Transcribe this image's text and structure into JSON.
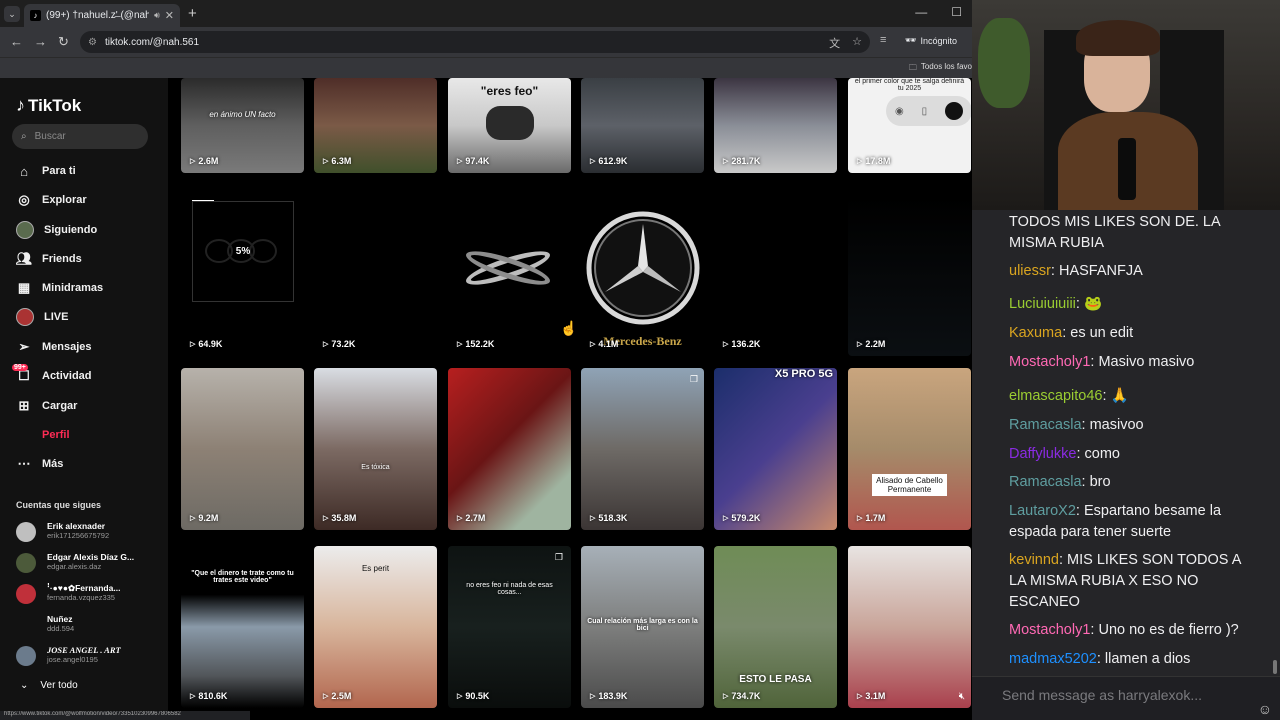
{
  "browser": {
    "tab_title": "(99+) †nahuel.z'̶ (@nah.56",
    "url": "tiktok.com/@nah.561",
    "incognito_label": "Incógnito",
    "bookmarks_all": "Todos los favo",
    "status_url": "https://www.tiktok.com/@wolfmotion/video/7335102309967806582"
  },
  "sidebar": {
    "brand": "TikTok",
    "search_placeholder": "Buscar",
    "nav": [
      {
        "label": "Para ti",
        "icon": "home-icon"
      },
      {
        "label": "Explorar",
        "icon": "compass-icon"
      },
      {
        "label": "Siguiendo",
        "icon": "following-avatar-icon"
      },
      {
        "label": "Friends",
        "icon": "friends-icon"
      },
      {
        "label": "Minidramas",
        "icon": "film-icon"
      },
      {
        "label": "LIVE",
        "icon": "live-avatar-icon"
      },
      {
        "label": "Mensajes",
        "icon": "send-icon"
      },
      {
        "label": "Actividad",
        "icon": "activity-icon",
        "badge": "99+"
      },
      {
        "label": "Cargar",
        "icon": "plus-square-icon"
      },
      {
        "label": "Perfil",
        "icon": "profile-icon"
      },
      {
        "label": "Más",
        "icon": "more-dots-icon"
      }
    ],
    "follows_title": "Cuentas que sigues",
    "follows": [
      {
        "name": "Erik alexnader",
        "handle": "erik171256675792"
      },
      {
        "name": "Edgar Alexis Díaz G...",
        "handle": "edgar.alexis.daz"
      },
      {
        "name": "ꜝ·●♥●✿Fernanda...",
        "handle": "fernanda.vzquez335"
      },
      {
        "name": "Nuñez",
        "handle": "ddd.594"
      },
      {
        "name": "JOSE ANGEL . ART",
        "handle": "jose.angel0195"
      }
    ],
    "see_all": "Ver todo"
  },
  "grid": {
    "row1": [
      {
        "views": "2.6M",
        "caption": "en ánimo UN facto"
      },
      {
        "views": "6.3M",
        "caption": ""
      },
      {
        "views": "97.4K",
        "caption": "\"eres feo\""
      },
      {
        "views": "612.9K",
        "caption": ""
      },
      {
        "views": "281.7K",
        "caption": ""
      },
      {
        "views": "17.8M",
        "caption": "el primer color que te salga definirá tu 2025"
      }
    ],
    "row2": [
      {
        "views": "64.9K",
        "caption": "",
        "loading": "5%"
      },
      {
        "views": "73.2K",
        "caption": ""
      },
      {
        "views": "152.2K",
        "caption": ""
      },
      {
        "views": "4.1M",
        "caption": "Mercedes-Benz"
      },
      {
        "views": "136.2K",
        "caption": ""
      },
      {
        "views": "2.2M",
        "caption": ""
      }
    ],
    "row3": [
      {
        "views": "9.2M",
        "caption": ""
      },
      {
        "views": "35.8M",
        "caption": "Es tóxica"
      },
      {
        "views": "2.7M",
        "caption": ""
      },
      {
        "views": "518.3K",
        "caption": ""
      },
      {
        "views": "579.2K",
        "caption": "X5 PRO 5G"
      },
      {
        "views": "1.7M",
        "caption": "Alisado de Cabello Permanente"
      }
    ],
    "row4": [
      {
        "views": "810.6K",
        "caption": "\"Que el dinero te trate como tu trates este video\""
      },
      {
        "views": "2.5M",
        "caption": "Es perit"
      },
      {
        "views": "90.5K",
        "caption": "no eres feo ni nada de esas cosas..."
      },
      {
        "views": "183.9K",
        "caption": "Cual relación más larga es con la bici"
      },
      {
        "views": "734.7K",
        "caption": "ESTO LE PASA"
      },
      {
        "views": "3.1M",
        "caption": ""
      }
    ]
  },
  "chat": {
    "messages": [
      {
        "user": "",
        "text": "TODOS MIS LIKES SON DE. LA MISMA RUBIA",
        "color": "#efeff1"
      },
      {
        "user": "uliessr",
        "text": "HASFANFJA",
        "color": "#daa520"
      },
      {
        "user": "Luciuiuiuiii",
        "text": "",
        "color": "#9acd32",
        "emote": "🐸"
      },
      {
        "user": "Kaxuma",
        "text": "es un edit",
        "color": "#daa520"
      },
      {
        "user": "Mostacholy1",
        "text": "Masivo masivo",
        "color": "#ff69b4"
      },
      {
        "user": "elmascapito46",
        "text": "",
        "color": "#9acd32",
        "emote": "🙏"
      },
      {
        "user": "Ramacasla",
        "text": "masivoo",
        "color": "#5f9ea0"
      },
      {
        "user": "Daffylukke",
        "text": "como",
        "color": "#8a2be2"
      },
      {
        "user": "Ramacasla",
        "text": "bro",
        "color": "#5f9ea0"
      },
      {
        "user": "LautaroX2",
        "text": "Espartano besame la espada para tener suerte",
        "color": "#5f9ea0"
      },
      {
        "user": "kevinnd",
        "text": "MIS LIKES SON TODOS A LA MISMA RUBIA X ESO NO ESCANEO",
        "color": "#daa520"
      },
      {
        "user": "Mostacholy1",
        "text": "Uno no es de fierro )?",
        "color": "#ff69b4"
      },
      {
        "user": "madmax5202",
        "text": "llamen a dios",
        "color": "#1e90ff"
      }
    ],
    "input_placeholder": "Send message as harryalexok..."
  }
}
